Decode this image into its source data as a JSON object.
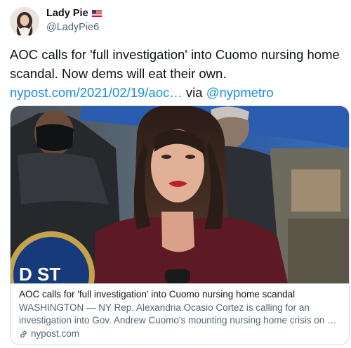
{
  "author": {
    "display_name": "Lady Pie",
    "flag_icon": "us-flag-icon",
    "handle": "@LadyPie6"
  },
  "tweet": {
    "text_1": "AOC calls for 'full investigation' into Cuomo nursing home scandal. Now dems will eat their own. ",
    "link": "nypost.com/2021/02/19/aoc…",
    "text_2": " via ",
    "mention": "@nypmetro"
  },
  "card": {
    "title": "AOC calls for 'full investigation' into Cuomo nursing home scandal",
    "description": "WASHINGTON — NY Rep. Alexandria Ocasio Cortez is calling for an investigation into Gov. Andrew Cuomo's mounting nursing home crisis on …",
    "domain": "nypost.com",
    "domain_icon": "link-icon"
  },
  "colors": {
    "link": "#1b8ce0",
    "secondary_text": "#536471",
    "border": "#cfd9de"
  }
}
